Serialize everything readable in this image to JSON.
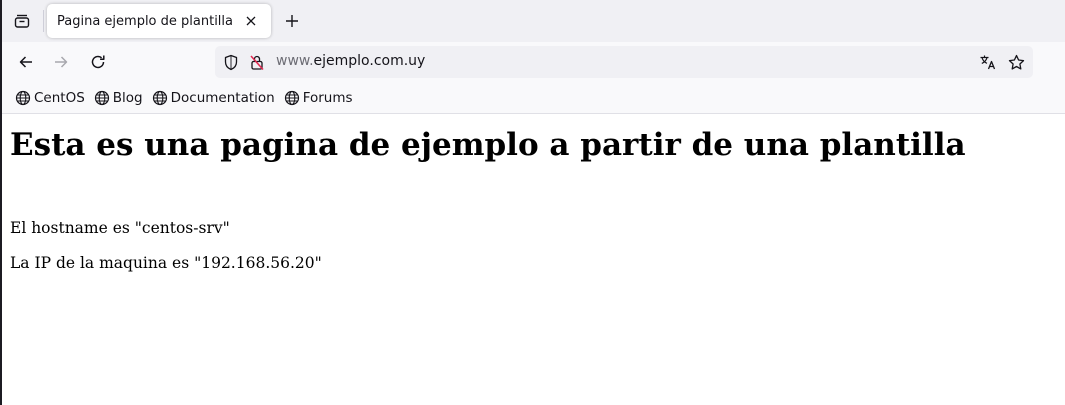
{
  "tab": {
    "title": "Pagina ejemplo de plantilla"
  },
  "url": {
    "prefix": "www.",
    "domain": "ejemplo.com.uy"
  },
  "bookmarks": [
    {
      "label": "CentOS"
    },
    {
      "label": "Blog"
    },
    {
      "label": "Documentation"
    },
    {
      "label": "Forums"
    }
  ],
  "page": {
    "heading": "Esta es una pagina de ejemplo a partir de una plantilla",
    "hostname_line": "El hostname es \"centos-srv\"",
    "ip_line": "La IP de la maquina es \"192.168.56.20\""
  },
  "icons": {
    "tab_tray": "tab-tray-icon",
    "close": "close-icon",
    "new_tab": "plus-icon",
    "back": "arrow-left-icon",
    "forward": "arrow-right-icon",
    "reload": "reload-icon",
    "shield": "shield-icon",
    "lock": "insecure-lock-icon",
    "translate": "translate-icon",
    "bookmark": "star-icon",
    "globe": "globe-icon"
  }
}
